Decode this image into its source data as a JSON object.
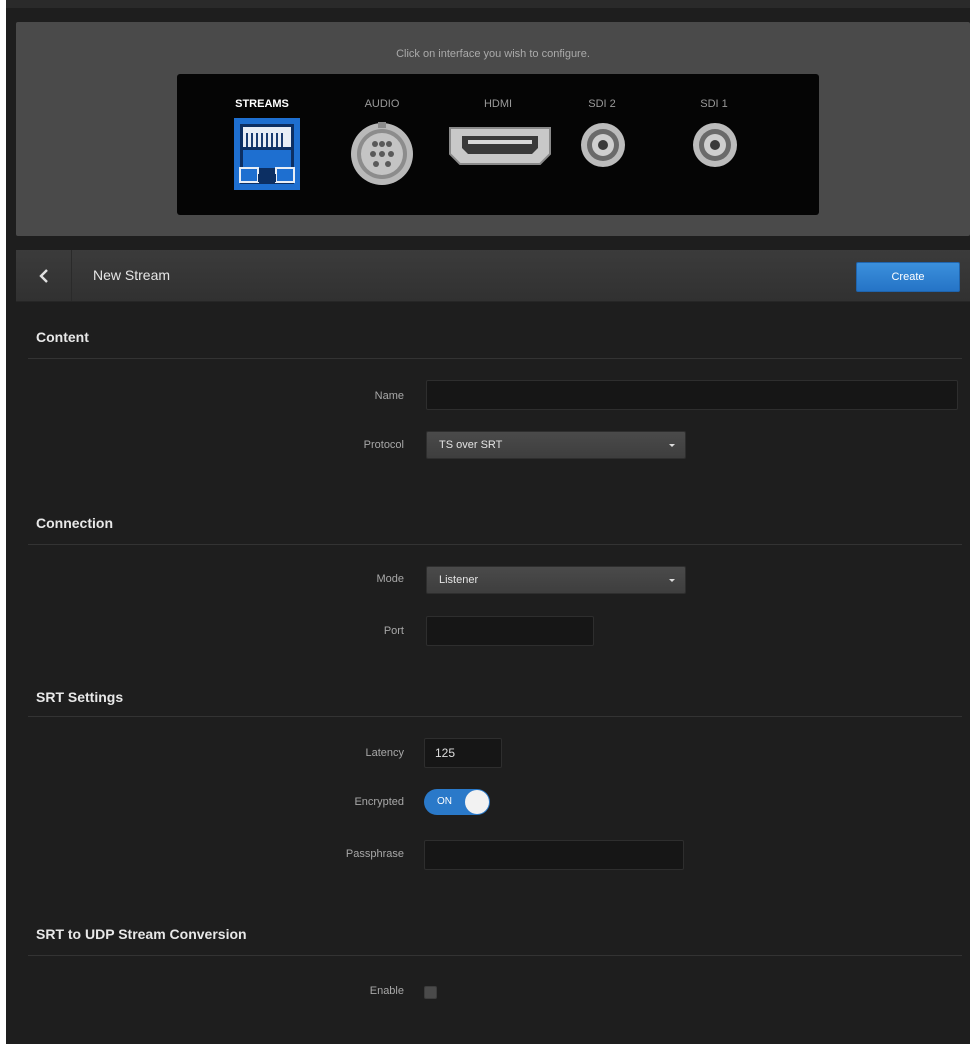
{
  "interface_selector": {
    "hint": "Click on interface you wish to configure.",
    "interfaces": [
      {
        "label": "STREAMS",
        "icon": "ethernet-port-icon",
        "active": true
      },
      {
        "label": "AUDIO",
        "icon": "audio-connector-icon",
        "active": false
      },
      {
        "label": "HDMI",
        "icon": "hdmi-port-icon",
        "active": false
      },
      {
        "label": "SDI 2",
        "icon": "bnc-connector-icon",
        "active": false
      },
      {
        "label": "SDI 1",
        "icon": "bnc-connector-icon",
        "active": false
      }
    ]
  },
  "header": {
    "back_icon": "chevron-left-icon",
    "title": "New Stream",
    "create_label": "Create"
  },
  "sections": {
    "content": {
      "title": "Content",
      "name_label": "Name",
      "name_value": "",
      "protocol_label": "Protocol",
      "protocol_value": "TS over SRT"
    },
    "connection": {
      "title": "Connection",
      "mode_label": "Mode",
      "mode_value": "Listener",
      "port_label": "Port",
      "port_value": ""
    },
    "srt_settings": {
      "title": "SRT Settings",
      "latency_label": "Latency",
      "latency_value": "125",
      "encrypted_label": "Encrypted",
      "encrypted_state": "ON",
      "passphrase_label": "Passphrase",
      "passphrase_value": ""
    },
    "srt_to_udp": {
      "title": "SRT to UDP Stream Conversion",
      "enable_label": "Enable",
      "enable_checked": false
    }
  },
  "colors": {
    "background": "#1e1e1e",
    "accent_blue": "#2a79c9",
    "active_interface": "#1e6fd0"
  }
}
